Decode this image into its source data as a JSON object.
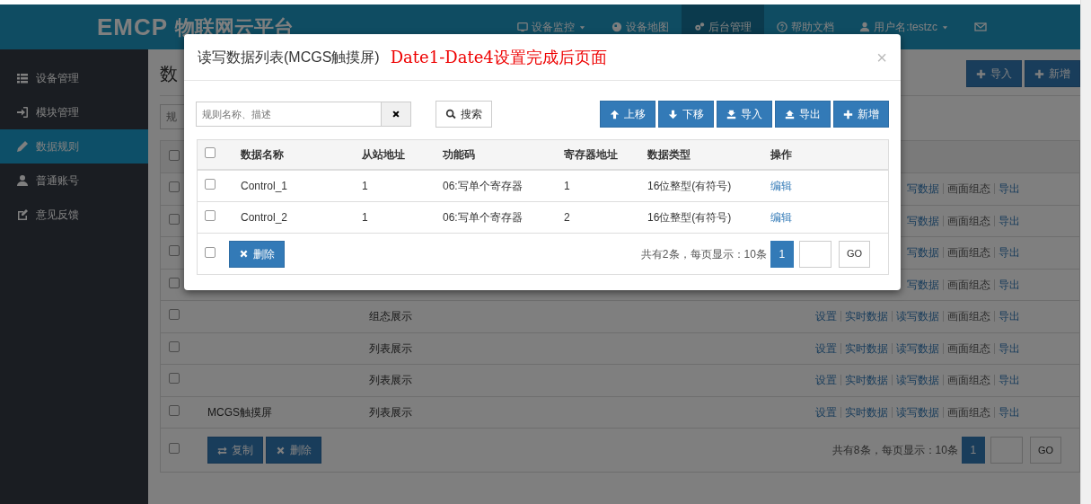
{
  "navbar": {
    "logo": "EMCP",
    "title": "物联网云平台",
    "items": [
      {
        "label": "设备监控",
        "dropdown": true,
        "selected": false
      },
      {
        "label": "设备地图",
        "dropdown": false,
        "selected": false
      },
      {
        "label": "后台管理",
        "dropdown": false,
        "selected": true
      },
      {
        "label": "帮助文档",
        "dropdown": false,
        "selected": false
      },
      {
        "label": "用户名:testzc",
        "dropdown": true,
        "selected": false
      }
    ]
  },
  "sidebar": {
    "items": [
      {
        "label": "设备管理",
        "selected": false
      },
      {
        "label": "模块管理",
        "selected": false
      },
      {
        "label": "数据规则",
        "selected": true
      },
      {
        "label": "普通账号",
        "selected": false
      },
      {
        "label": "意见反馈",
        "selected": false
      }
    ]
  },
  "page": {
    "title": "数",
    "search": {
      "placeholder": "规"
    },
    "header_checked": false,
    "buttons": [
      "导入",
      "新增"
    ],
    "rows": [
      {
        "checked": false,
        "actions": [
          {
            "label": "写数据",
            "disabled": false
          },
          {
            "label": "画面组态",
            "disabled": true
          },
          {
            "label": "导出",
            "disabled": false
          }
        ]
      },
      {
        "checked": false,
        "actions": [
          {
            "label": "写数据",
            "disabled": false
          },
          {
            "label": "画面组态",
            "disabled": true
          },
          {
            "label": "导出",
            "disabled": false
          }
        ]
      },
      {
        "checked": false,
        "actions": [
          {
            "label": "写数据",
            "disabled": false
          },
          {
            "label": "画面组态",
            "disabled": true
          },
          {
            "label": "导出",
            "disabled": false
          }
        ]
      },
      {
        "checked": false,
        "actions": [
          {
            "label": "写数据",
            "disabled": false
          },
          {
            "label": "画面组态",
            "disabled": true
          },
          {
            "label": "导出",
            "disabled": false
          }
        ]
      },
      {
        "checked": false,
        "type": "组态展示",
        "actions": [
          {
            "label": "设置",
            "disabled": false
          },
          {
            "label": "实时数据",
            "disabled": false
          },
          {
            "label": "读写数据",
            "disabled": false
          },
          {
            "label": "画面组态",
            "disabled": true
          },
          {
            "label": "导出",
            "disabled": false
          }
        ]
      },
      {
        "checked": false,
        "type": "列表展示",
        "actions": [
          {
            "label": "设置",
            "disabled": false
          },
          {
            "label": "实时数据",
            "disabled": false
          },
          {
            "label": "读写数据",
            "disabled": false
          },
          {
            "label": "画面组态",
            "disabled": true
          },
          {
            "label": "导出",
            "disabled": false
          }
        ]
      },
      {
        "checked": false,
        "type": "列表展示",
        "actions": [
          {
            "label": "设置",
            "disabled": false
          },
          {
            "label": "实时数据",
            "disabled": false
          },
          {
            "label": "读写数据",
            "disabled": false
          },
          {
            "label": "画面组态",
            "disabled": true
          },
          {
            "label": "导出",
            "disabled": false
          }
        ]
      },
      {
        "checked": false,
        "name": "MCGS触摸屏",
        "type": "列表展示",
        "actions": [
          {
            "label": "设置",
            "disabled": false
          },
          {
            "label": "实时数据",
            "disabled": false
          },
          {
            "label": "读写数据",
            "disabled": false
          },
          {
            "label": "画面组态",
            "disabled": true
          },
          {
            "label": "导出",
            "disabled": false
          }
        ]
      }
    ],
    "footer": {
      "checked": false,
      "buttons": [
        "复制",
        "删除"
      ],
      "summary": "共有8条，每页显示：10条",
      "pages": [
        {
          "label": "1",
          "selected": true
        }
      ],
      "go": "GO"
    }
  },
  "modal": {
    "title": "读写数据列表(MCGS触摸屏)",
    "annotation": "Date1-Date4设置完成后页面",
    "close": "×",
    "search": {
      "placeholder": "规则名称、描述"
    },
    "search_button": "搜索",
    "toolbar": [
      "上移",
      "下移",
      "导入",
      "导出",
      "新增"
    ],
    "table": {
      "header_checked": false,
      "columns": [
        "数据名称",
        "从站地址",
        "功能码",
        "寄存器地址",
        "数据类型",
        "操作"
      ],
      "rows": [
        {
          "checked": false,
          "cells": [
            "Control_1",
            "1",
            "06:写单个寄存器",
            "1",
            "16位整型(有符号)"
          ],
          "action": "编辑"
        },
        {
          "checked": false,
          "cells": [
            "Control_2",
            "1",
            "06:写单个寄存器",
            "2",
            "16位整型(有符号)"
          ],
          "action": "编辑"
        }
      ]
    },
    "footer": {
      "checked": false,
      "delete": "删除",
      "summary": "共有2条，每页显示：10条",
      "pages": [
        {
          "label": "1",
          "selected": true
        }
      ],
      "go": "GO"
    }
  }
}
